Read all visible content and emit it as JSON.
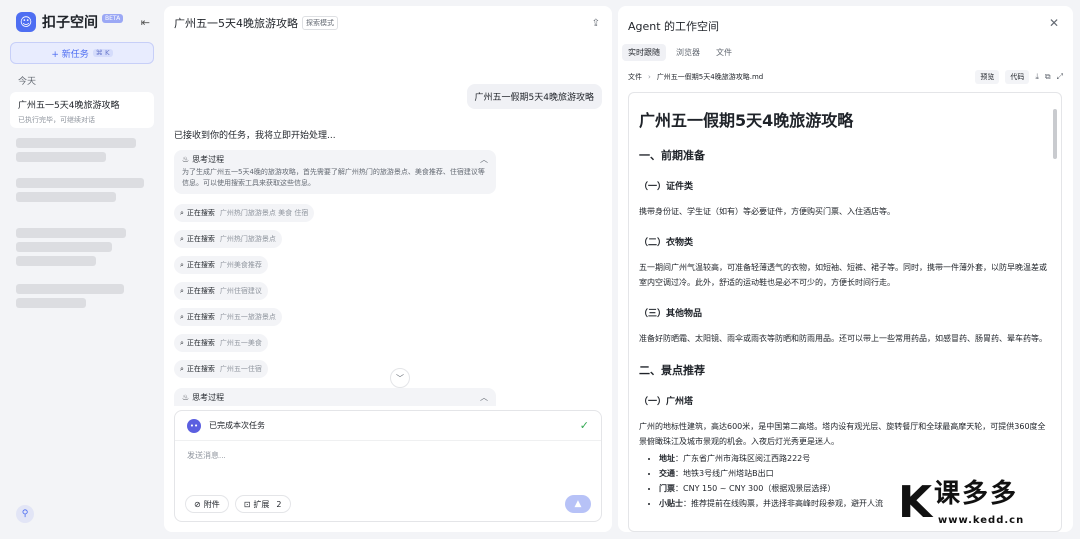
{
  "sidebar": {
    "brand_name": "扣子空间",
    "brand_badge": "BETA",
    "new_task_label": "+ 新任务",
    "new_task_kbd": "⌘ K",
    "today_label": "今天",
    "tasks": [
      {
        "title": "广州五一5天4晚旅游攻略",
        "subtitle": "已执行完毕，可继续对话"
      }
    ]
  },
  "chat": {
    "title": "广州五一5天4晚旅游攻略",
    "mode_badge": "探索模式",
    "user_message": "广州五一假期5天4晚旅游攻略",
    "ack_message": "已接收到你的任务，我将立即开始处理...",
    "thinking_label": "思考过程",
    "thinking_text": "为了生成广州五一5天4晚的旅游攻略，首先需要了解广州热门的旅游景点、美食推荐、住宿建议等信息。可以使用搜索工具来获取这些信息。",
    "searching_label": "正在搜索",
    "searches": [
      "广州热门旅游景点 美食 住宿",
      "广州热门旅游景点",
      "广州美食推荐",
      "广州住宿建议",
      "广州五一旅游景点",
      "广州五一美食",
      "广州五一住宿"
    ],
    "thinking_label_2": "思考过程",
    "done_label": "已完成本次任务",
    "input_placeholder": "发送消息...",
    "attach_label": "附件",
    "extend_label": "扩展",
    "extend_count": "2"
  },
  "workspace": {
    "title": "Agent 的工作空间",
    "tabs": [
      "实时跟随",
      "浏览器",
      "文件"
    ],
    "path_root": "文件",
    "path_file": "广州五一假期5天4晚旅游攻略.md",
    "preview_label": "预览",
    "code_label": "代码",
    "doc": {
      "h1": "广州五一假期5天4晚旅游攻略",
      "s1": "一、前期准备",
      "s1a": "（一）证件类",
      "p1": "携带身份证、学生证（如有）等必要证件，方便购买门票、入住酒店等。",
      "s1b": "（二）衣物类",
      "p2": "五一期间广州气温较高，可准备轻薄透气的衣物，如短袖、短裤、裙子等。同时，携带一件薄外套，以防早晚温差或室内空调过冷。此外，舒适的运动鞋也是必不可少的，方便长时间行走。",
      "s1c": "（三）其他物品",
      "p3": "准备好防晒霜、太阳镜、雨伞或雨衣等防晒和防雨用品。还可以带上一些常用药品，如感冒药、肠胃药、晕车药等。",
      "s2": "二、景点推荐",
      "s2a": "（一）广州塔",
      "p4": "广州的地标性建筑，高达600米，是中国第二高塔。塔内设有观光层、旋转餐厅和全球最高摩天轮，可提供360度全景俯瞰珠江及城市景观的机会。入夜后灯光秀更是迷人。",
      "facts": [
        {
          "k": "地址",
          "v": "：广东省广州市海珠区阅江西路222号"
        },
        {
          "k": "交通",
          "v": "：地铁3号线广州塔站B出口"
        },
        {
          "k": "门票",
          "v": "：CNY 150 ~ CNY 300（根据观景层选择）"
        },
        {
          "k": "小贴士",
          "v": "：推荐提前在线购票，并选择非高峰时段参观，避开人流"
        }
      ]
    }
  },
  "watermark": {
    "cn": "课多多",
    "url": "www.kedd.cn"
  }
}
